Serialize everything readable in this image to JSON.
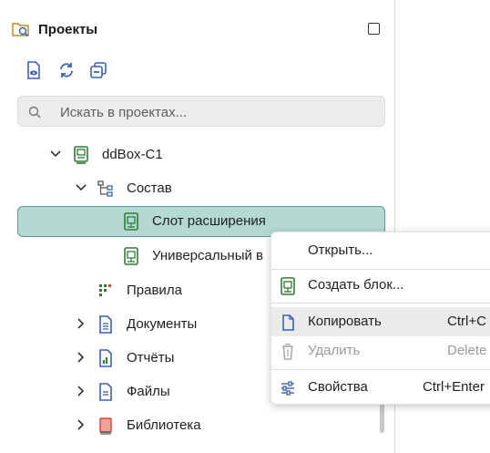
{
  "panel": {
    "title": "Проекты",
    "search": {
      "placeholder": "Искать в проектах..."
    }
  },
  "tree": {
    "root": {
      "label": "ddBox-C1"
    },
    "composition": {
      "label": "Состав"
    },
    "items": [
      {
        "label": "Слот расширения"
      },
      {
        "label": "Универсальный в"
      }
    ],
    "rules": {
      "label": "Правила"
    },
    "documents": {
      "label": "Документы"
    },
    "reports": {
      "label": "Отчёты"
    },
    "files": {
      "label": "Файлы"
    },
    "library": {
      "label": "Библиотека"
    }
  },
  "context_menu": {
    "open": {
      "label": "Открыть..."
    },
    "create_block": {
      "label": "Создать блок..."
    },
    "copy": {
      "label": "Копировать",
      "shortcut": "Ctrl+C"
    },
    "delete": {
      "label": "Удалить",
      "shortcut": "Delete"
    },
    "properties": {
      "label": "Свойства",
      "shortcut": "Ctrl+Enter"
    }
  },
  "colors": {
    "accent_green": "#2e7d32",
    "selection_bg": "#b4d8d2",
    "selection_border": "#5a9a90",
    "doc_blue": "#3a62b0",
    "library_red": "#d9463b"
  }
}
